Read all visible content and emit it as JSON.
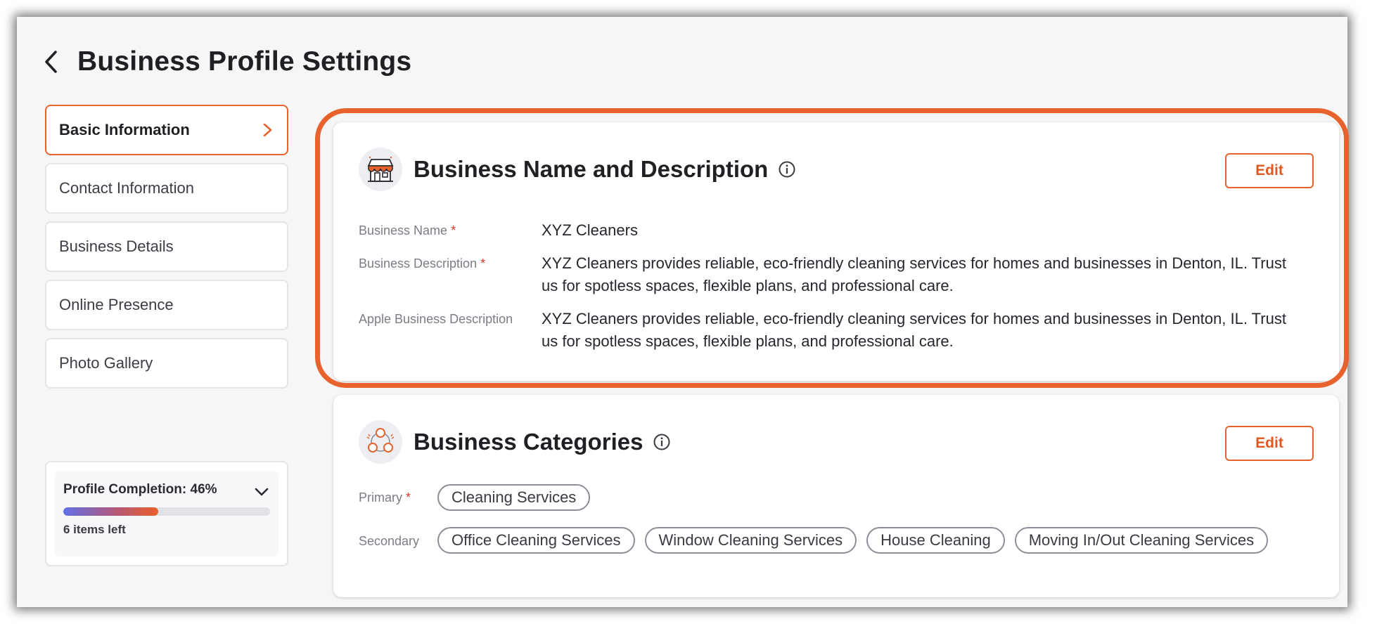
{
  "page": {
    "title": "Business Profile Settings"
  },
  "colors": {
    "accent": "#e8622d",
    "required": "#e0382b"
  },
  "sidebar": {
    "items": [
      {
        "label": "Basic Information",
        "active": true
      },
      {
        "label": "Contact Information"
      },
      {
        "label": "Business Details"
      },
      {
        "label": "Online Presence"
      },
      {
        "label": "Photo Gallery"
      }
    ]
  },
  "completion": {
    "label": "Profile Completion: 46%",
    "percent": 46,
    "items_left": "6 items left"
  },
  "name_card": {
    "title": "Business Name and Description",
    "edit_label": "Edit",
    "icon": "storefront-icon",
    "fields": [
      {
        "label": "Business Name",
        "required": "*",
        "value": "XYZ Cleaners"
      },
      {
        "label": "Business Description",
        "required": "*",
        "value": "XYZ Cleaners provides reliable, eco-friendly cleaning services for homes and businesses in Denton, IL. Trust us for spotless spaces, flexible plans, and professional care."
      },
      {
        "label": "Apple Business Description",
        "value": "XYZ Cleaners provides reliable, eco-friendly cleaning services for homes and businesses in Denton, IL. Trust us for spotless spaces, flexible plans, and professional care."
      }
    ]
  },
  "categories_card": {
    "title": "Business Categories",
    "edit_label": "Edit",
    "icon": "categories-icon",
    "primary_label": "Primary",
    "primary_required": "*",
    "primary": [
      "Cleaning Services"
    ],
    "secondary_label": "Secondary",
    "secondary": [
      "Office Cleaning Services",
      "Window Cleaning Services",
      "House Cleaning",
      "Moving In/Out Cleaning Services"
    ]
  }
}
